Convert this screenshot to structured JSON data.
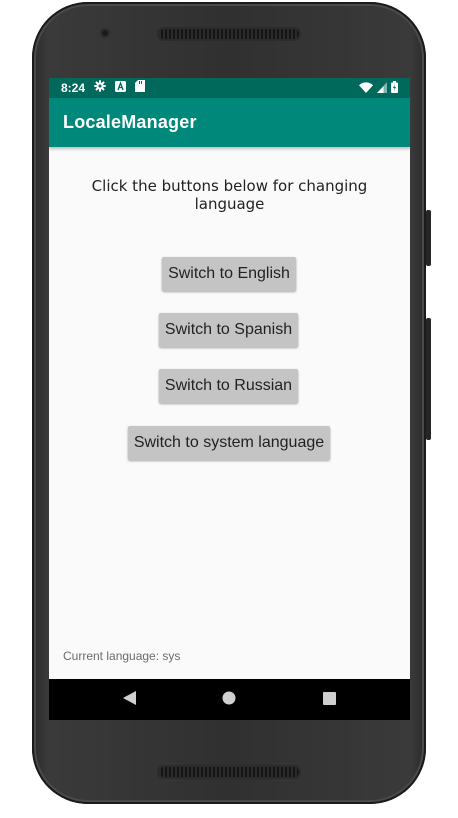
{
  "status_bar": {
    "time": "8:24",
    "icons_left": [
      "gear-icon",
      "a-notification-icon",
      "sd-card-icon"
    ],
    "icons_right": [
      "wifi-icon",
      "cell-signal-icon",
      "battery-icon"
    ]
  },
  "app_bar": {
    "title": "LocaleManager",
    "color": "#00897b",
    "status_color": "#00695c"
  },
  "main": {
    "instructions": "Click the buttons below for changing language",
    "buttons": [
      {
        "label": "Switch to English"
      },
      {
        "label": "Switch to Spanish"
      },
      {
        "label": "Switch to Russian"
      },
      {
        "label": "Switch to system language"
      }
    ],
    "current_language": "Current language: sys"
  },
  "nav_bar": {
    "icons": [
      "back-icon",
      "home-icon",
      "recents-icon"
    ]
  }
}
